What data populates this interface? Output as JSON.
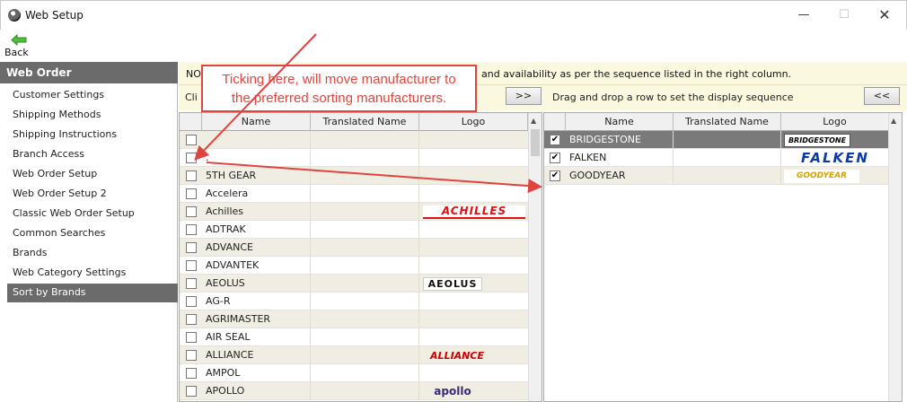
{
  "window": {
    "title": "Web Setup",
    "minimize": "—",
    "maximize": "☐",
    "close": "✕"
  },
  "toolbar": {
    "back_label": "Back"
  },
  "sidebar": {
    "header": "Web Order",
    "items": [
      {
        "label": "Customer Settings"
      },
      {
        "label": "Shipping Methods"
      },
      {
        "label": "Shipping Instructions"
      },
      {
        "label": "Branch Access"
      },
      {
        "label": "Web Order Setup"
      },
      {
        "label": "Web Order Setup 2"
      },
      {
        "label": "Classic Web Order Setup"
      },
      {
        "label": "Common Searches"
      },
      {
        "label": "Brands"
      },
      {
        "label": "Web Category Settings"
      },
      {
        "label": "Sort by Brands"
      }
    ]
  },
  "notice": {
    "prefix": "NO",
    "text": "and availability as per the sequence listed in the right column."
  },
  "controls": {
    "left_text": "Cli",
    "move_right": ">>",
    "drag_hint": "Drag and drop a row to set the display sequence",
    "move_left": "<<"
  },
  "left_grid": {
    "headers": [
      "Name",
      "Translated Name",
      "Logo"
    ],
    "rows": [
      {
        "name": "",
        "logo": ""
      },
      {
        "name": ".",
        "logo": ""
      },
      {
        "name": "5TH GEAR",
        "logo": ""
      },
      {
        "name": "Accelera",
        "logo": ""
      },
      {
        "name": "Achilles",
        "logo": "ACHILLES"
      },
      {
        "name": "ADTRAK",
        "logo": ""
      },
      {
        "name": "ADVANCE",
        "logo": ""
      },
      {
        "name": "ADVANTEK",
        "logo": ""
      },
      {
        "name": "AEOLUS",
        "logo": "AEOLUS"
      },
      {
        "name": "AG-R",
        "logo": ""
      },
      {
        "name": "AGRIMASTER",
        "logo": ""
      },
      {
        "name": "AIR SEAL",
        "logo": ""
      },
      {
        "name": "ALLIANCE",
        "logo": "ALLIANCE"
      },
      {
        "name": "AMPOL",
        "logo": ""
      },
      {
        "name": "APOLLO",
        "logo": "apollo"
      }
    ]
  },
  "right_grid": {
    "headers": [
      "Name",
      "Translated Name",
      "Logo"
    ],
    "rows": [
      {
        "name": "BRIDGESTONE",
        "logo": "BRIDGESTONE",
        "check": "✔"
      },
      {
        "name": "FALKEN",
        "logo": "FALKEN",
        "check": "✔"
      },
      {
        "name": "GOODYEAR",
        "logo": "GOODYEAR",
        "check": "✔"
      }
    ]
  },
  "annotation": {
    "line1": "Ticking here, will move manufacturer to",
    "line2": "the preferred sorting manufacturers."
  },
  "colors": {
    "accent_red": "#e0443e",
    "selected_gray": "#6b6b6b",
    "notice_bg": "#fbf8e0"
  }
}
